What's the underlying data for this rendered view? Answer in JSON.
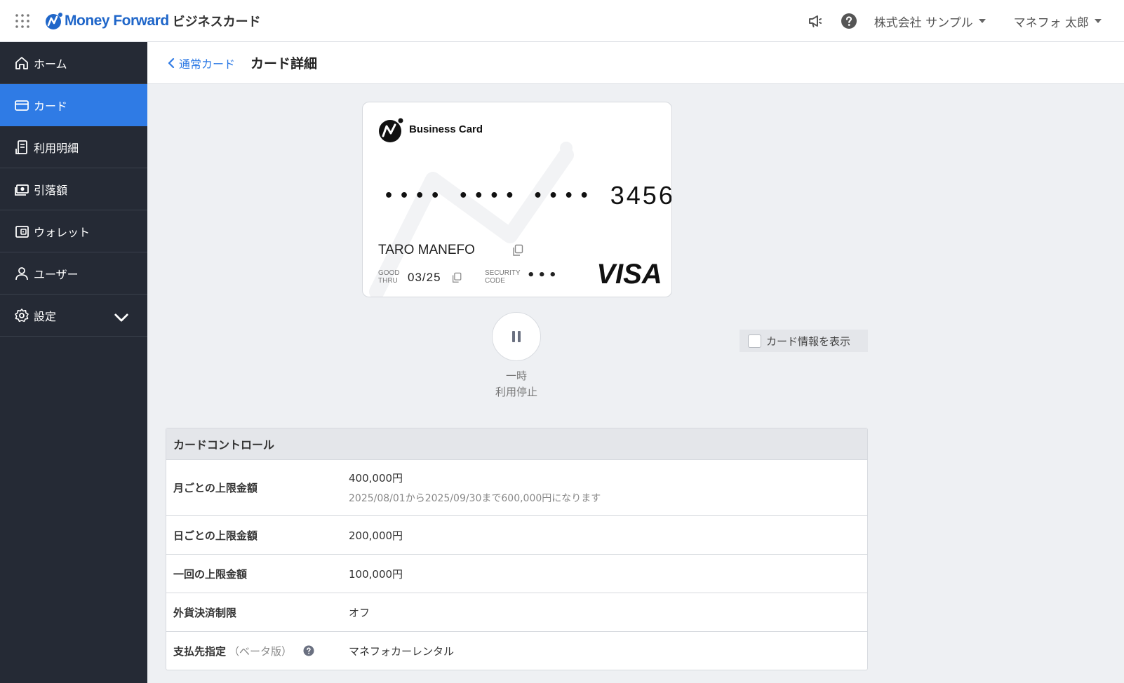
{
  "header": {
    "logo_text": "Money Forward",
    "logo_sub": "ビジネスカード",
    "company": "株式会社 サンプル",
    "user": "マネフォ 太郎"
  },
  "sidebar": {
    "items": [
      {
        "label": "ホーム",
        "icon": "home-icon"
      },
      {
        "label": "カード",
        "icon": "card-icon",
        "active": true
      },
      {
        "label": "利用明細",
        "icon": "statement-icon"
      },
      {
        "label": "引落額",
        "icon": "money-icon"
      },
      {
        "label": "ウォレット",
        "icon": "wallet-icon"
      },
      {
        "label": "ユーザー",
        "icon": "user-icon"
      },
      {
        "label": "設定",
        "icon": "gear-icon",
        "expandable": true
      }
    ]
  },
  "breadcrumb": {
    "back": "通常カード",
    "title": "カード詳細"
  },
  "card": {
    "brand": "Business Card",
    "masked": [
      "••••",
      "••••",
      "••••"
    ],
    "last4": "3456",
    "holder": "TARO MANEFO",
    "good_thru_label_1": "GOOD",
    "good_thru_label_2": "THRU",
    "expiry": "03/25",
    "security_label_1": "SECURITY",
    "security_label_2": "CODE",
    "security_code": "•••",
    "network": "VISA"
  },
  "pause": {
    "line1": "一時",
    "line2": "利用停止"
  },
  "show_info_label": "カード情報を表示",
  "control": {
    "title": "カードコントロール",
    "rows": [
      {
        "label": "月ごとの上限金額",
        "value": "400,000円",
        "sub": "2025/08/01から2025/09/30まで600,000円になります"
      },
      {
        "label": "日ごとの上限金額",
        "value": "200,000円"
      },
      {
        "label": "一回の上限金額",
        "value": "100,000円"
      },
      {
        "label": "外貨決済制限",
        "value": "オフ"
      },
      {
        "label": "支払先指定",
        "beta": "（ベータ版）",
        "value": "マネフォカーレンタル"
      }
    ]
  },
  "colors": {
    "accent": "#2f7be5",
    "sidebar_bg": "#252a35",
    "brand_blue": "#1f66c9"
  }
}
